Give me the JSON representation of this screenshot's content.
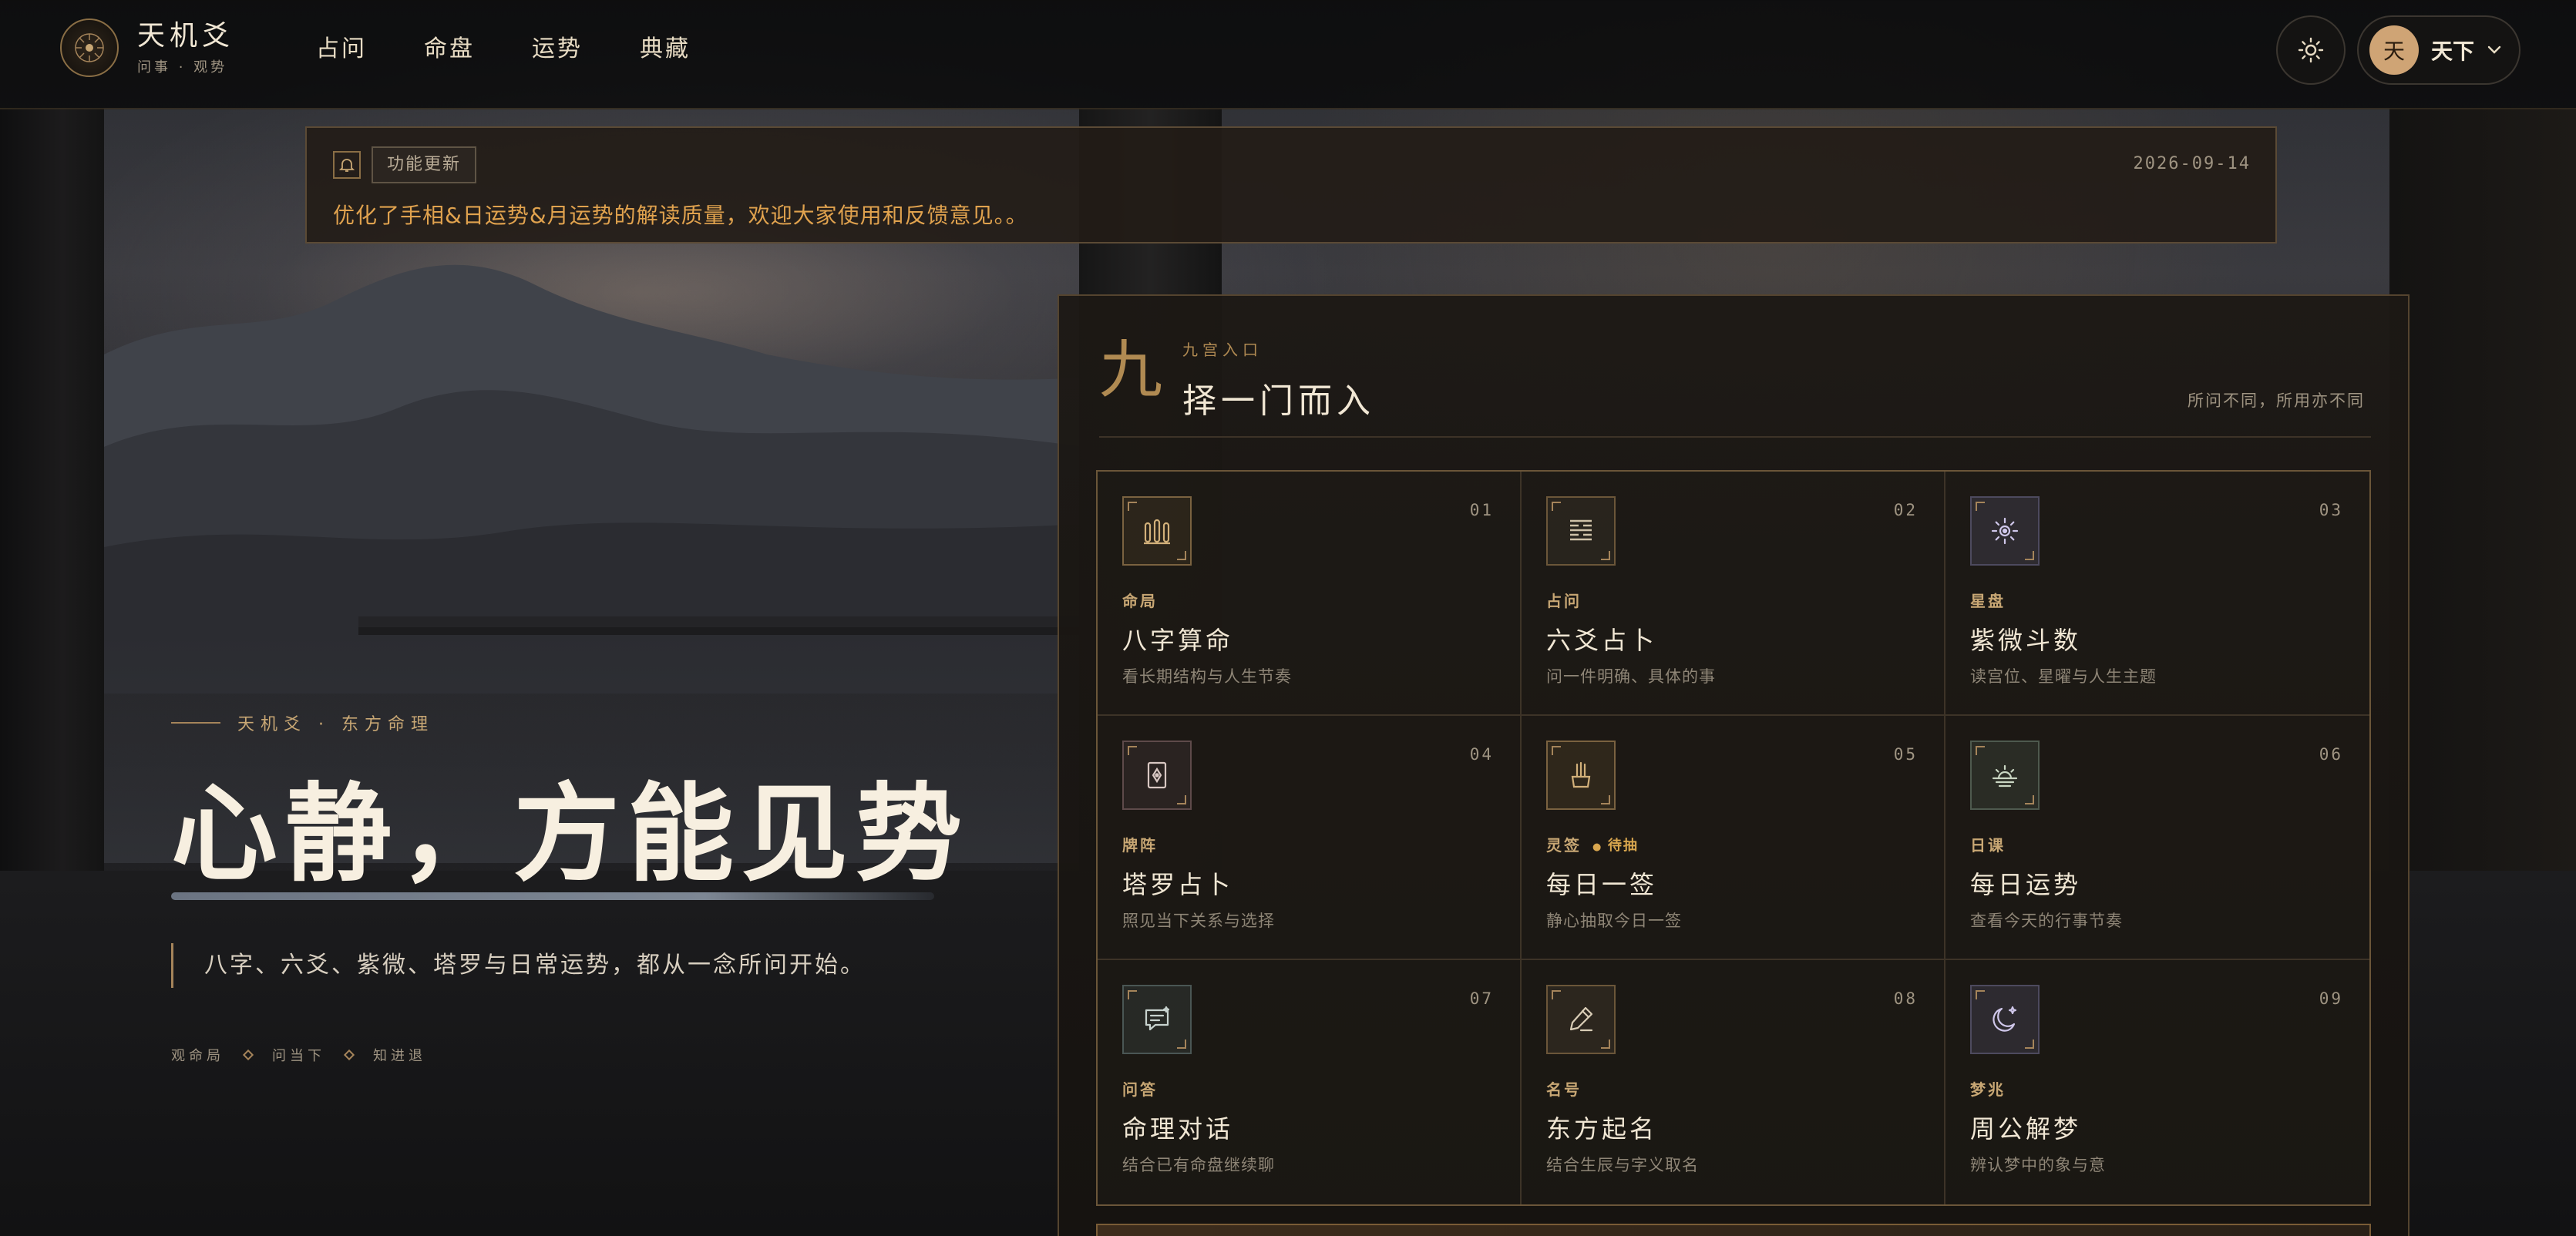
{
  "header": {
    "brand_name": "天机爻",
    "brand_sub": "问事 · 观势",
    "nav": [
      "占问",
      "命盘",
      "运势",
      "典藏"
    ],
    "user_initial": "天",
    "user_name": "天下"
  },
  "notice": {
    "tag": "功能更新",
    "date": "2026-09-14",
    "message": "优化了手相&日运势&月运势的解读质量，欢迎大家使用和反馈意见。。"
  },
  "hero": {
    "kicker": "天机爻 · 东方命理",
    "title": "心静，方能见势",
    "subtitle": "八字、六爻、紫微、塔罗与日常运势，都从一念所问开始。",
    "tags": [
      "观命局",
      "问当下",
      "知进退"
    ]
  },
  "panel": {
    "numeral": "九",
    "kicker": "九宫入口",
    "title": "择一门而入",
    "note": "所问不同，所用亦不同",
    "cards": [
      {
        "index": "01",
        "category": "命局",
        "name": "八字算命",
        "desc": "看长期结构与人生节奏",
        "icon": "bazi-pillars-icon",
        "badge": ""
      },
      {
        "index": "02",
        "category": "占问",
        "name": "六爻占卜",
        "desc": "问一件明确、具体的事",
        "icon": "hexagram-icon",
        "badge": ""
      },
      {
        "index": "03",
        "category": "星盘",
        "name": "紫微斗数",
        "desc": "读宫位、星曜与人生主题",
        "icon": "star-sun-icon",
        "badge": ""
      },
      {
        "index": "04",
        "category": "牌阵",
        "name": "塔罗占卜",
        "desc": "照见当下关系与选择",
        "icon": "tarot-card-icon",
        "badge": ""
      },
      {
        "index": "05",
        "category": "灵签",
        "name": "每日一签",
        "desc": "静心抽取今日一签",
        "icon": "fortune-sticks-icon",
        "badge": "待抽"
      },
      {
        "index": "06",
        "category": "日课",
        "name": "每日运势",
        "desc": "查看今天的行事节奏",
        "icon": "sunrise-icon",
        "badge": ""
      },
      {
        "index": "07",
        "category": "问答",
        "name": "命理对话",
        "desc": "结合已有命盘继续聊",
        "icon": "chat-icon",
        "badge": ""
      },
      {
        "index": "08",
        "category": "名号",
        "name": "东方起名",
        "desc": "结合生辰与字义取名",
        "icon": "brush-pen-icon",
        "badge": ""
      },
      {
        "index": "09",
        "category": "梦兆",
        "name": "周公解梦",
        "desc": "辨认梦中的象与意",
        "icon": "moon-stars-icon",
        "badge": ""
      }
    ]
  },
  "colors": {
    "accent_gold": "#c8a774",
    "notice_text": "#e0a24e",
    "panel_border": "#6b5639",
    "icon_green": "#7fa08a",
    "icon_gold": "#d2b07a",
    "icon_violet": "#b3aad6"
  }
}
